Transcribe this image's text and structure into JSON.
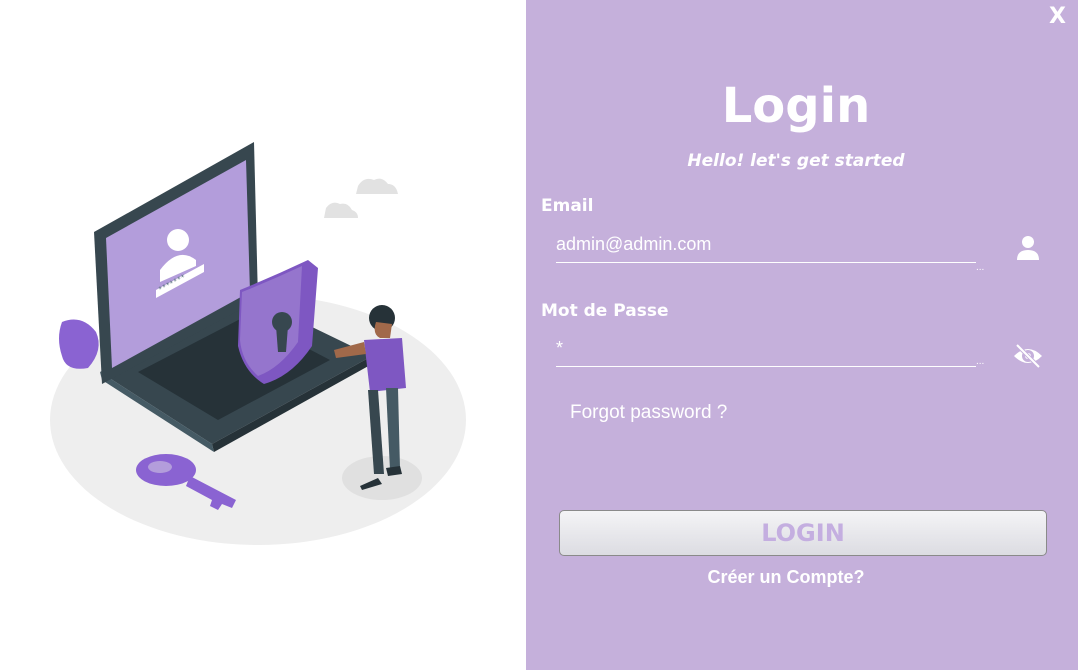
{
  "window": {
    "close_label": "X"
  },
  "header": {
    "title": "Login",
    "subtitle": "Hello!  let's get started"
  },
  "form": {
    "email": {
      "label": "Email",
      "value": "admin@admin.com",
      "icon": "user-icon"
    },
    "password": {
      "label": "Mot de Passe",
      "value": "*",
      "icon": "eye-slash-icon"
    },
    "overflow_marker": "...",
    "forgot_password": "Forgot password ?",
    "login_button": "LOGIN",
    "create_account": "Créer un Compte?"
  },
  "illustration": {
    "subject": "laptop-security-illustration",
    "password_mask": "*******"
  },
  "colors": {
    "panel_background": "#c5b0db",
    "accent": "#7c4dc4",
    "button_text": "#c4aee0"
  }
}
